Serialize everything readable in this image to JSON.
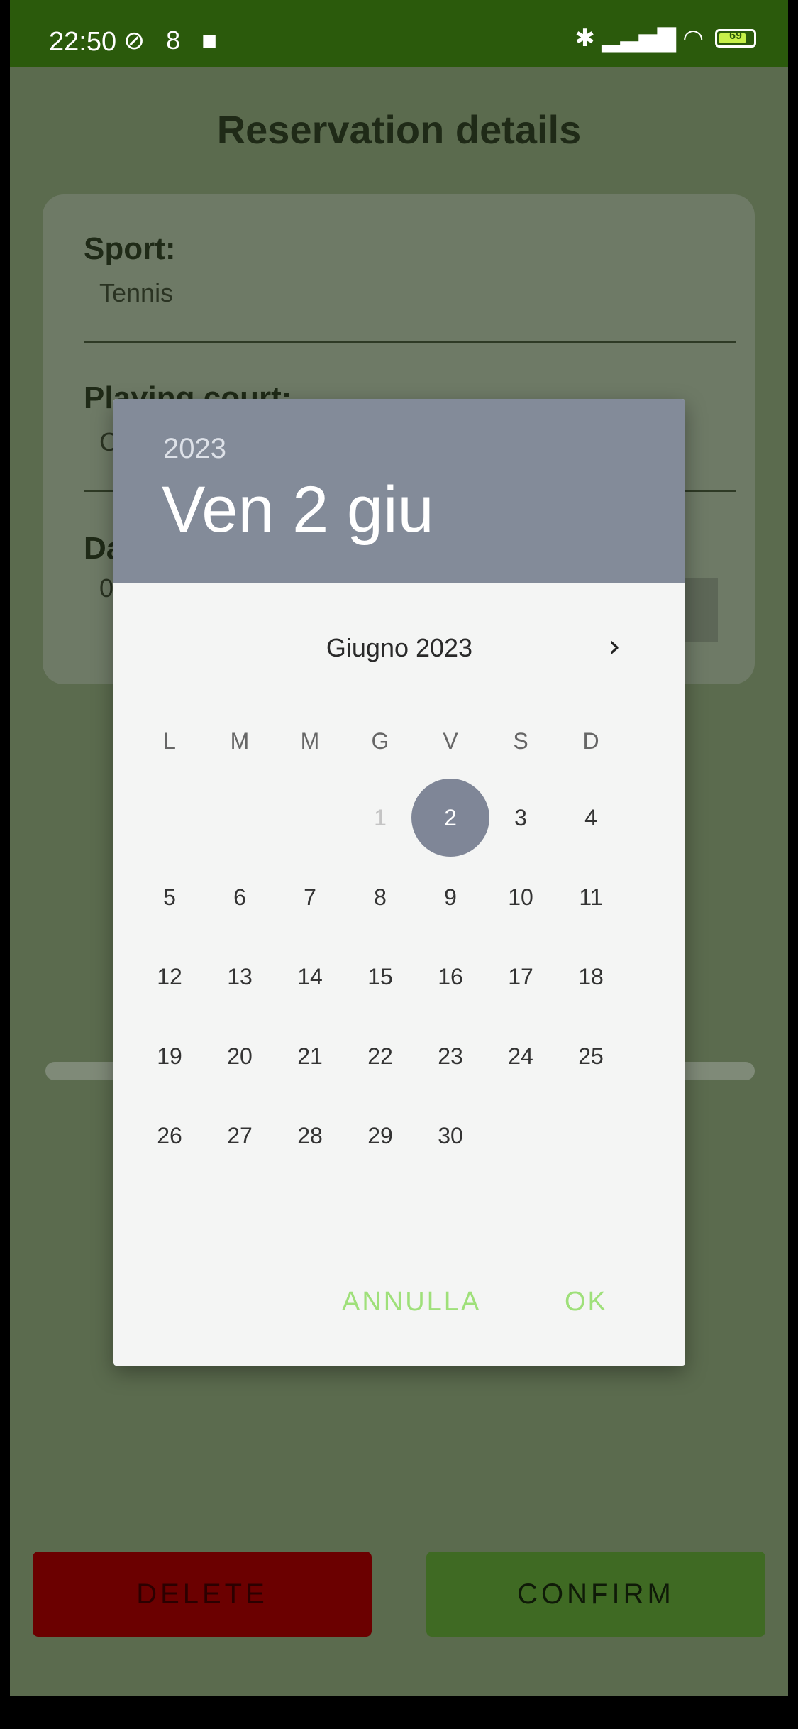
{
  "status_bar": {
    "time": "22:50",
    "left_icons": [
      "do-not-disturb-icon",
      "notification-icon",
      "video-icon"
    ],
    "left_glyphs": "⊘ 8 ■",
    "right_glyphs": "✱ ▂▃▅▇ ◠",
    "battery": "69"
  },
  "page": {
    "title": "Reservation details",
    "fields": [
      {
        "label": "Sport:",
        "value": "Tennis"
      },
      {
        "label": "Playing court:",
        "value": "C"
      },
      {
        "label": "Da",
        "value": "0"
      }
    ],
    "delete_label": "DELETE",
    "confirm_label": "CONFIRM"
  },
  "dialog": {
    "year": "2023",
    "selected_date": "Ven 2 giu",
    "month_label": "Giugno 2023",
    "next_icon": "chevron-right-icon",
    "weekdays": [
      "L",
      "M",
      "M",
      "G",
      "V",
      "S",
      "D"
    ],
    "first_weekday_index": 3,
    "days_in_month": 30,
    "disabled_days": [
      1
    ],
    "selected_day": 2,
    "cancel_label": "ANNULLA",
    "ok_label": "OK"
  },
  "colors": {
    "status_bar": "#2b5a0c",
    "dialog_header": "#838b99",
    "selected_day": "#7f8697",
    "dialog_action": "#9fe07a",
    "delete": "#6b0000",
    "confirm": "#3f6a23"
  }
}
